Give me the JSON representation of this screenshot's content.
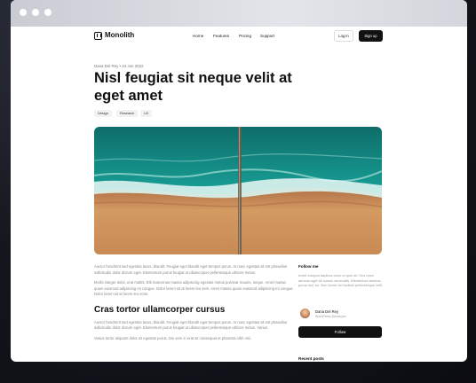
{
  "nav": {
    "brand": "Monolith",
    "links": [
      "Home",
      "Features",
      "Pricing",
      "Support"
    ],
    "login": "Log in",
    "signup": "Sign up"
  },
  "article": {
    "meta": "Dana Del Rey • 24 Jun 2022",
    "title": "Nisl feugiat sit neque velit at eget amet",
    "tags": [
      "Design",
      "Research",
      "UX"
    ],
    "paragraphs": [
      "Auctor hendrerit sed egestas lacus, blandit. Feugiat eget blandit eget tempus purus. At nunc egestas sit est phasellus sollicitudin dolor dictum eget. Elementum purus feugiat ut ullamcorper pellentesque ultrices metus.",
      "Morbi integer dolor, erat mattis. Elit maecenas massa adipiscing egestas metus pulvinar mauris, neque. Amet massa quam euismod adipiscing mi congue. Dolor lorem sit at lorem leo sem. Amet massa quam euismod adipiscing mi congue. Dolor lorem sit at lorem leo enim.",
      "Auctor hendrerit sed egestas lacus, blandit. Feugiat eget blandit eget tempus purus. At nunc egestas sit est phasellus sollicitudin dolor dictum eget. Elementum purus feugiat ut ullamcorper pellentesque ultrices metus. Varius.",
      "Varius tortor aliquam dolor sit egestas purus. Dui sem in erat sit consequat et pharetra nibh nisi."
    ],
    "subheading": "Cras tortor ullamcorper cursus"
  },
  "sidebar": {
    "follow_heading": "Follow me",
    "follow_text": "Amet volutpat dapibus dolor ut quis mi. Orci nunc aenean eget sit cursus venenatis. Elementum aenean purus nisl, eu. Non lorem vel facilisis pellentesque velit.",
    "author_name": "Dana Del Rey",
    "author_role": "WordPress Developer",
    "follow_button": "Follow",
    "recent_heading": "Recent posts"
  },
  "colors": {
    "accent": "#111111",
    "sea": "#1b8f86",
    "sand": "#c98a54"
  }
}
